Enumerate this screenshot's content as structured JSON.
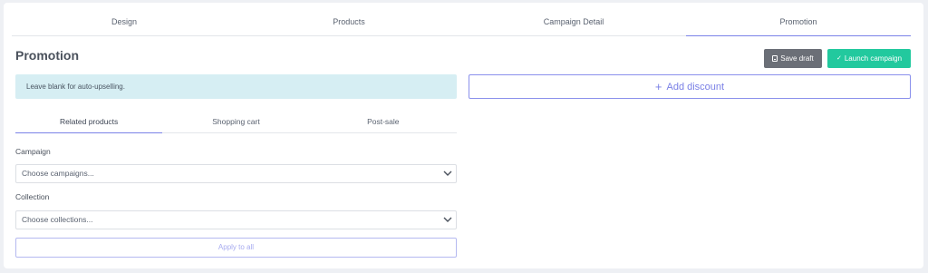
{
  "steps": [
    "Design",
    "Products",
    "Campaign Detail",
    "Promotion"
  ],
  "active_step": "Promotion",
  "page_title": "Promotion",
  "actions": {
    "save_draft": "Save draft",
    "launch": "Launch campaign"
  },
  "alert": "Leave blank for auto-upselling.",
  "add_discount": "Add discount",
  "subtabs": [
    "Related products",
    "Shopping cart",
    "Post-sale"
  ],
  "active_subtab": "Related products",
  "campaign": {
    "label": "Campaign",
    "placeholder": "Choose campaigns..."
  },
  "collection": {
    "label": "Collection",
    "placeholder": "Choose collections..."
  },
  "apply_all": "Apply to all",
  "colors": {
    "accent": "#7b82e8",
    "launch": "#22c99e",
    "draft": "#6b6f77",
    "alert_bg": "#d6eef3"
  }
}
